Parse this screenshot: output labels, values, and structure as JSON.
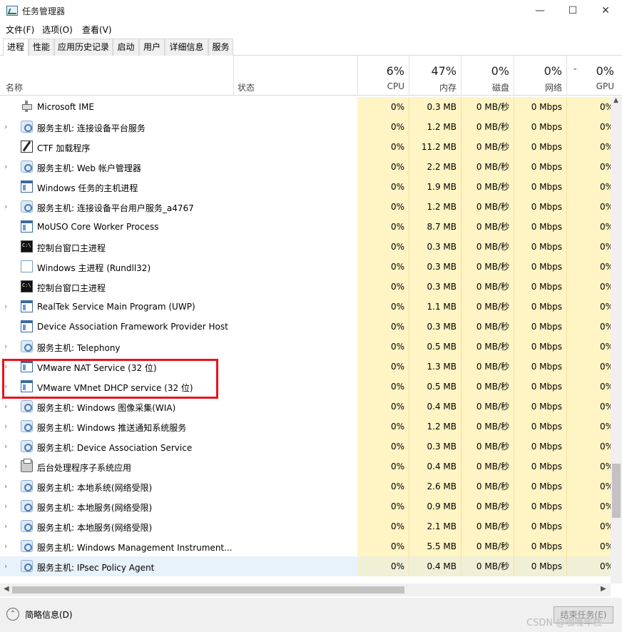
{
  "window": {
    "title": "任务管理器",
    "minimize": "—",
    "maximize": "☐",
    "close": "✕"
  },
  "menu": [
    "文件(F)",
    "选项(O)",
    "查看(V)"
  ],
  "tabs": [
    "进程",
    "性能",
    "应用历史记录",
    "启动",
    "用户",
    "详细信息",
    "服务"
  ],
  "header": {
    "name_label": "名称",
    "status_label": "状态",
    "sort_glyph": "⌄",
    "columns": [
      {
        "pct": "6%",
        "label": "CPU"
      },
      {
        "pct": "47%",
        "label": "内存"
      },
      {
        "pct": "0%",
        "label": "磁盘"
      },
      {
        "pct": "0%",
        "label": "网络"
      },
      {
        "pct": "0%",
        "label": "GPU"
      }
    ]
  },
  "rows": [
    {
      "expand": "",
      "icon": "ime-icon",
      "name": "Microsoft IME",
      "cpu": "0%",
      "mem": "0.3 MB",
      "disk": "0 MB/秒",
      "net": "0 Mbps",
      "gpu": "0%"
    },
    {
      "expand": "›",
      "icon": "gear-icon",
      "name": "服务主机: 连接设备平台服务",
      "cpu": "0%",
      "mem": "1.2 MB",
      "disk": "0 MB/秒",
      "net": "0 Mbps",
      "gpu": "0%"
    },
    {
      "expand": "",
      "icon": "pen-icon",
      "name": "CTF 加载程序",
      "cpu": "0%",
      "mem": "11.2 MB",
      "disk": "0 MB/秒",
      "net": "0 Mbps",
      "gpu": "0%"
    },
    {
      "expand": "›",
      "icon": "gear-icon",
      "name": "服务主机: Web 帐户管理器",
      "cpu": "0%",
      "mem": "2.2 MB",
      "disk": "0 MB/秒",
      "net": "0 Mbps",
      "gpu": "0%"
    },
    {
      "expand": "",
      "icon": "window-icon",
      "name": "Windows 任务的主机进程",
      "cpu": "0%",
      "mem": "1.9 MB",
      "disk": "0 MB/秒",
      "net": "0 Mbps",
      "gpu": "0%"
    },
    {
      "expand": "›",
      "icon": "gear-icon",
      "name": "服务主机: 连接设备平台用户服务_a4767",
      "cpu": "0%",
      "mem": "1.2 MB",
      "disk": "0 MB/秒",
      "net": "0 Mbps",
      "gpu": "0%"
    },
    {
      "expand": "",
      "icon": "window-icon",
      "name": "MoUSO Core Worker Process",
      "cpu": "0%",
      "mem": "8.7 MB",
      "disk": "0 MB/秒",
      "net": "0 Mbps",
      "gpu": "0%"
    },
    {
      "expand": "",
      "icon": "console-icon",
      "name": "控制台窗口主进程",
      "cpu": "0%",
      "mem": "0.3 MB",
      "disk": "0 MB/秒",
      "net": "0 Mbps",
      "gpu": "0%"
    },
    {
      "expand": "",
      "icon": "document-icon",
      "name": "Windows 主进程 (Rundll32)",
      "cpu": "0%",
      "mem": "0.3 MB",
      "disk": "0 MB/秒",
      "net": "0 Mbps",
      "gpu": "0%"
    },
    {
      "expand": "",
      "icon": "console-icon",
      "name": "控制台窗口主进程",
      "cpu": "0%",
      "mem": "0.3 MB",
      "disk": "0 MB/秒",
      "net": "0 Mbps",
      "gpu": "0%"
    },
    {
      "expand": "›",
      "icon": "window-icon",
      "name": "RealTek Service Main Program (UWP)",
      "cpu": "0%",
      "mem": "1.1 MB",
      "disk": "0 MB/秒",
      "net": "0 Mbps",
      "gpu": "0%"
    },
    {
      "expand": "",
      "icon": "window-icon",
      "name": "Device Association Framework Provider Host",
      "cpu": "0%",
      "mem": "0.3 MB",
      "disk": "0 MB/秒",
      "net": "0 Mbps",
      "gpu": "0%"
    },
    {
      "expand": "›",
      "icon": "gear-icon",
      "name": "服务主机: Telephony",
      "cpu": "0%",
      "mem": "0.5 MB",
      "disk": "0 MB/秒",
      "net": "0 Mbps",
      "gpu": "0%"
    },
    {
      "expand": "›",
      "icon": "window-icon",
      "name": "VMware NAT Service (32 位)",
      "cpu": "0%",
      "mem": "1.3 MB",
      "disk": "0 MB/秒",
      "net": "0 Mbps",
      "gpu": "0%"
    },
    {
      "expand": "›",
      "icon": "window-icon",
      "name": "VMware VMnet DHCP service (32 位)",
      "cpu": "0%",
      "mem": "0.5 MB",
      "disk": "0 MB/秒",
      "net": "0 Mbps",
      "gpu": "0%"
    },
    {
      "expand": "›",
      "icon": "gear-icon",
      "name": "服务主机: Windows 图像采集(WIA)",
      "cpu": "0%",
      "mem": "0.4 MB",
      "disk": "0 MB/秒",
      "net": "0 Mbps",
      "gpu": "0%"
    },
    {
      "expand": "›",
      "icon": "gear-icon",
      "name": "服务主机: Windows 推送通知系统服务",
      "cpu": "0%",
      "mem": "1.2 MB",
      "disk": "0 MB/秒",
      "net": "0 Mbps",
      "gpu": "0%"
    },
    {
      "expand": "›",
      "icon": "gear-icon",
      "name": "服务主机: Device Association Service",
      "cpu": "0%",
      "mem": "0.3 MB",
      "disk": "0 MB/秒",
      "net": "0 Mbps",
      "gpu": "0%"
    },
    {
      "expand": "›",
      "icon": "printer-icon",
      "name": "后台处理程序子系统应用",
      "cpu": "0%",
      "mem": "0.4 MB",
      "disk": "0 MB/秒",
      "net": "0 Mbps",
      "gpu": "0%"
    },
    {
      "expand": "›",
      "icon": "gear-icon",
      "name": "服务主机: 本地系统(网络受限)",
      "cpu": "0%",
      "mem": "2.6 MB",
      "disk": "0 MB/秒",
      "net": "0 Mbps",
      "gpu": "0%"
    },
    {
      "expand": "›",
      "icon": "gear-icon",
      "name": "服务主机: 本地服务(网络受限)",
      "cpu": "0%",
      "mem": "0.9 MB",
      "disk": "0 MB/秒",
      "net": "0 Mbps",
      "gpu": "0%"
    },
    {
      "expand": "›",
      "icon": "gear-icon",
      "name": "服务主机: 本地服务(网络受限)",
      "cpu": "0%",
      "mem": "2.1 MB",
      "disk": "0 MB/秒",
      "net": "0 Mbps",
      "gpu": "0%"
    },
    {
      "expand": "›",
      "icon": "gear-icon",
      "name": "服务主机: Windows Management Instrument...",
      "cpu": "0%",
      "mem": "5.5 MB",
      "disk": "0 MB/秒",
      "net": "0 Mbps",
      "gpu": "0%"
    },
    {
      "expand": "›",
      "icon": "gear-icon",
      "name": "服务主机: IPsec Policy Agent",
      "cpu": "0%",
      "mem": "0.4 MB",
      "disk": "0 MB/秒",
      "net": "0 Mbps",
      "gpu": "0%",
      "selected": true
    }
  ],
  "footer": {
    "collapse_glyph": "⌃",
    "fewer_details": "简略信息(D)",
    "end_task": "结束任务(E)"
  },
  "watermark": "CSDN @咖喱年糕",
  "colors": {
    "column_bg": "#fff4c4",
    "highlight_border": "#e8141b",
    "selected_row": "#e8f2fb"
  }
}
